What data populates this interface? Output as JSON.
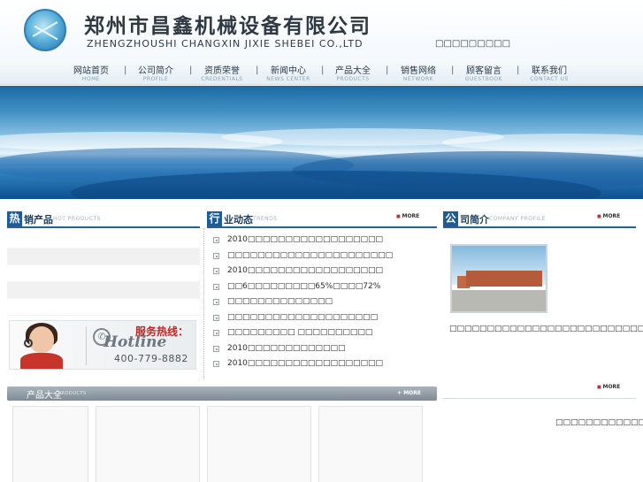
{
  "header": {
    "company_name": "郑州市昌鑫机械设备有限公司",
    "company_name_en": "ZHENGZHOUSHI CHANGXIN JIXIE SHEBEI CO.,LTD",
    "tagline": "□□□□□□□□□"
  },
  "nav": {
    "items": [
      {
        "cn": "网站首页",
        "en": "HOME"
      },
      {
        "cn": "公司简介",
        "en": "PROFILE"
      },
      {
        "cn": "资质荣誉",
        "en": "CREDENTIALS"
      },
      {
        "cn": "新闻中心",
        "en": "NEWS CENTER"
      },
      {
        "cn": "产品大全",
        "en": "PRODUCTS"
      },
      {
        "cn": "销售网络",
        "en": "NETWORK"
      },
      {
        "cn": "顾客留言",
        "en": "GUESTBOOK"
      },
      {
        "cn": "联系我们",
        "en": "CONTACT US"
      }
    ],
    "separator": "|"
  },
  "hot_products": {
    "title_first": "热",
    "title_rest": "销产品",
    "title_en": "HOT PRODUCTS"
  },
  "hotline": {
    "title": "服务热线：",
    "word": "Hotline",
    "number": "400-779-8882"
  },
  "news": {
    "title_first": "行",
    "title_rest": "业动态",
    "title_en": "TRENDS",
    "more": "MORE",
    "items": [
      "2010□□□□□□□□□□□□□□□□□□",
      "□□□□□□□□□□□□□□□□□□□□□□",
      "2010□□□□□□□□□□□□□□□□□□",
      "□□6□□□□□□□□□65%□□□□72%",
      "□□□□□□□□□□□□□□",
      "□□□□□□□□□□□□□□□□□□□□",
      "□□□□□□□□□ □□□□□□□□□□",
      "2010□□□□□□□□□□□□□",
      "2010□□□□□□□□□□□□□□□□□□"
    ]
  },
  "company_profile": {
    "title_first": "公",
    "title_rest": "司简介",
    "title_en": "COMPANY PROFILE",
    "more": "MORE",
    "text": "□□□□□□□□□□□□□□□□□□□□□□□□□□□□□□□□□□□□□□□□□□□□□□□□□□□□□□□□□□□□□□□□□□□□□□□□□□□□□□□□□□□□□□□□□□□□□□□□□□□□□□□□□□□□□□□□□□□□□□□□□□□□□□□□□□□□□□□□□□□□□□□□□□□□□□"
  },
  "contact": {
    "more": "MORE",
    "text": "□□□□□□□□□□□□□□□□“□□□□□□□□□”□□□□□□□□□□□□□□□□□□□□□□□□□□□□□□□□□"
  },
  "products": {
    "title": "产品大全",
    "title_en": "PRODUCTS",
    "more": "+ MORE"
  },
  "colors": {
    "accent": "#1f5c95",
    "hotline_red": "#c5241f",
    "products_bar": "#8c979f"
  },
  "icons": {
    "logo": "globe-logo-icon",
    "bullet": "square-bullet-icon",
    "phone": "phone-icon"
  }
}
